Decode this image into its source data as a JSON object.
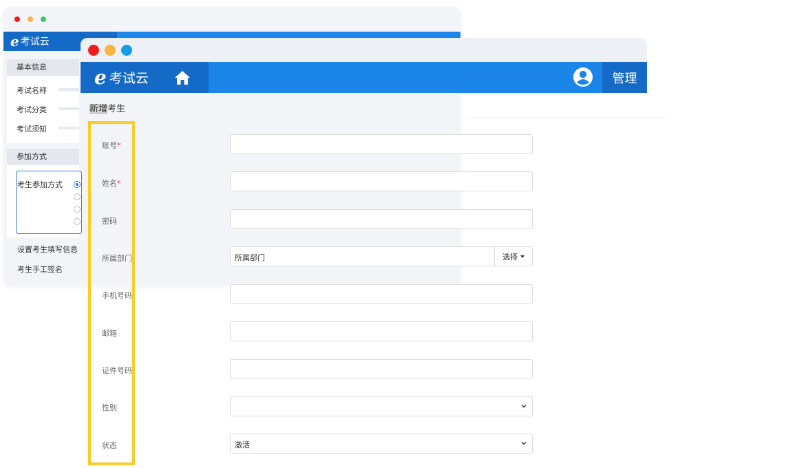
{
  "back_window": {
    "logo_text": "考试云",
    "sections": {
      "basic_info": "基本信息",
      "fields": [
        "考试名称",
        "考试分类",
        "考试须知"
      ],
      "participation": "参加方式",
      "participation_label": "考生参加方式",
      "links": [
        "设置考生填写信息",
        "考生手工签名"
      ]
    }
  },
  "front_window": {
    "logo_text": "考试云",
    "admin_label": "管理",
    "page_title_highlight": "新增",
    "page_title_rest": "考生",
    "form": {
      "account_label": "账号",
      "name_label": "姓名",
      "required_mark": "*",
      "password_label": "密码",
      "department_label": "所属部门",
      "department_value": "所属部门",
      "department_button": "选择",
      "phone_label": "手机号码",
      "email_label": "邮箱",
      "id_label": "证件号码",
      "gender_label": "性别",
      "gender_value": "",
      "status_label": "状态",
      "status_value": "激活"
    }
  },
  "colors": {
    "header_blue": "#1b86e8",
    "header_dark_blue": "#1569c7",
    "highlight_yellow": "#fccb2a",
    "dot_red": "#f01c1c",
    "dot_yellow": "#f9b441",
    "dot_blue": "#169be8"
  },
  "icons": {
    "home": "home-icon",
    "user": "user-circle-icon",
    "chevron": "chevron-down-icon"
  }
}
